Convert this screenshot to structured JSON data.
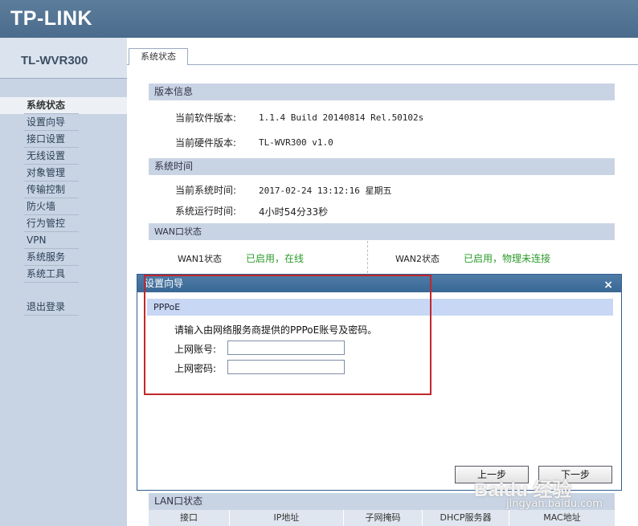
{
  "header": {
    "logo": "TP-LINK"
  },
  "sidebar": {
    "model": "TL-WVR300",
    "items": [
      {
        "label": "系统状态"
      },
      {
        "label": "设置向导"
      },
      {
        "label": "接口设置"
      },
      {
        "label": "无线设置"
      },
      {
        "label": "对象管理"
      },
      {
        "label": "传输控制"
      },
      {
        "label": "防火墙"
      },
      {
        "label": "行为管控"
      },
      {
        "label": "VPN"
      },
      {
        "label": "系统服务"
      },
      {
        "label": "系统工具"
      }
    ],
    "logout": "退出登录"
  },
  "tab": {
    "label": "系统状态"
  },
  "version": {
    "title": "版本信息",
    "software_label": "当前软件版本:",
    "software_value": "1.1.4 Build 20140814 Rel.50102s",
    "hardware_label": "当前硬件版本:",
    "hardware_value": "TL-WVR300 v1.0"
  },
  "time": {
    "title": "系统时间",
    "system_label": "当前系统时间:",
    "system_value": "2017-02-24 13:12:16 星期五",
    "uptime_label": "系统运行时间:",
    "uptime_value": "4小时54分33秒"
  },
  "wan": {
    "title": "WAN口状态",
    "wan1_label": "WAN1状态",
    "wan1_value": "已启用，在线",
    "wan2_label": "WAN2状态",
    "wan2_value": "已启用，物理未连接"
  },
  "lan": {
    "title": "LAN口状态",
    "columns": [
      "接口",
      "IP地址",
      "子网掩码",
      "DHCP服务器",
      "MAC地址"
    ]
  },
  "dialog": {
    "title": "设置向导",
    "close": "×",
    "section": "PPPoE",
    "instruction": "请输入由网络服务商提供的PPPoE账号及密码。",
    "account_label": "上网账号:",
    "account_value": "",
    "password_label": "上网密码:",
    "password_value": "",
    "prev": "上一步",
    "next": "下一步"
  },
  "watermark": {
    "main": "Baidu 经验",
    "sub": "jingyan.baidu.com"
  },
  "colors": {
    "header": "#4a6b8c",
    "sidebar": "#c8d4e4",
    "status_green": "#2b9a2b",
    "highlight": "#c1272d"
  }
}
